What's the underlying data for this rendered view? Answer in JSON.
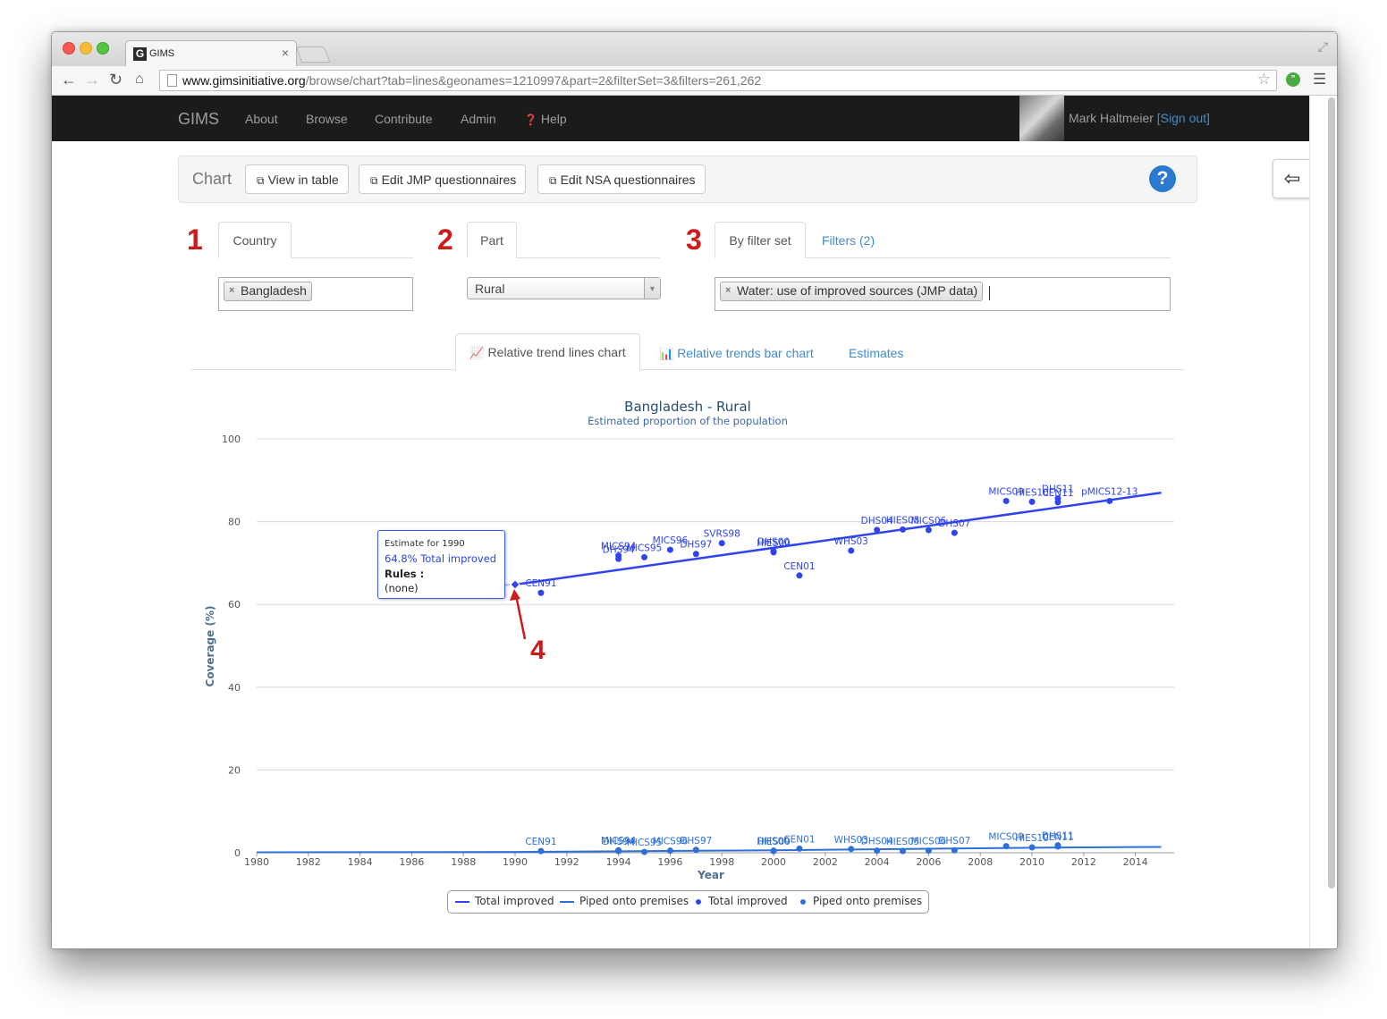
{
  "browser": {
    "tab_title": "GIMS",
    "favicon_letter": "G",
    "url_host": "www.gimsinitiative.org",
    "url_path": "/browse/chart?tab=lines&geonames=1210997&part=2&filterSet=3&filters=261,262"
  },
  "navbar": {
    "brand": "GIMS",
    "links": [
      "About",
      "Browse",
      "Contribute",
      "Admin",
      "Help"
    ],
    "user_name": "Mark Haltmeier",
    "sign_out": "[Sign out]"
  },
  "chart_toolbar": {
    "label": "Chart",
    "buttons": [
      "View in table",
      "Edit JMP questionnaires",
      "Edit NSA questionnaires"
    ]
  },
  "steps": {
    "one": "1",
    "two": "2",
    "three": "3",
    "four": "4"
  },
  "panels": {
    "country_tab": "Country",
    "country_value": "Bangladesh",
    "part_tab": "Part",
    "part_value": "Rural",
    "filterset_tab": "By filter set",
    "filters_tab": "Filters (2)",
    "filterset_value": "Water: use of improved sources (JMP data)"
  },
  "view_tabs": [
    "Relative trend lines chart",
    "Relative trends bar chart",
    "Estimates"
  ],
  "tooltip": {
    "header": "Estimate for 1990",
    "value": "64.8% Total improved",
    "rules_label": "Rules :",
    "rules_value": "(none)"
  },
  "colors": {
    "series_total_line": "#2f44ef",
    "series_piped_line": "#2f6fd8",
    "annotation_red": "#cc1b1b",
    "link_blue": "#428bca"
  },
  "chart_data": {
    "type": "scatter",
    "title": "Bangladesh - Rural",
    "subtitle": "Estimated proportion of the population",
    "xlabel": "Year",
    "ylabel": "Coverage (%)",
    "xlim": [
      1980,
      2015
    ],
    "ylim": [
      0,
      100
    ],
    "x_ticks": [
      1980,
      1982,
      1984,
      1986,
      1988,
      1990,
      1992,
      1994,
      1996,
      1998,
      2000,
      2002,
      2004,
      2006,
      2008,
      2010,
      2012,
      2014
    ],
    "y_ticks": [
      0,
      20,
      40,
      60,
      80,
      100
    ],
    "grid": true,
    "legend_position": "bottom-center",
    "legend": [
      "Total improved",
      "Piped onto premises",
      "Total improved",
      "Piped onto premises"
    ],
    "series": [
      {
        "name": "Total improved",
        "kind": "line",
        "color": "#2f44ef",
        "points": [
          [
            1990,
            64.8
          ],
          [
            2015,
            87
          ]
        ]
      },
      {
        "name": "Piped onto premises",
        "kind": "line",
        "color": "#2f6fd8",
        "points": [
          [
            1980,
            0.1
          ],
          [
            1990,
            0.2
          ],
          [
            2000,
            0.6
          ],
          [
            2010,
            1.2
          ],
          [
            2015,
            1.4
          ]
        ]
      },
      {
        "name": "Total improved",
        "kind": "points",
        "color": "#2f44ef",
        "points": [
          {
            "x": 1991,
            "y": 62.8,
            "label": "CEN91"
          },
          {
            "x": 1994,
            "y": 71.8,
            "label": "MICS94"
          },
          {
            "x": 1994,
            "y": 71.0,
            "label": "DHS94"
          },
          {
            "x": 1995,
            "y": 71.4,
            "label": "MICS95"
          },
          {
            "x": 1996,
            "y": 73.2,
            "label": "MICS96"
          },
          {
            "x": 1997,
            "y": 72.2,
            "label": "DHS97"
          },
          {
            "x": 1998,
            "y": 74.8,
            "label": "SVRS98"
          },
          {
            "x": 2000,
            "y": 72.6,
            "label": "HIES00"
          },
          {
            "x": 2000,
            "y": 72.9,
            "label": "DHS00"
          },
          {
            "x": 2001,
            "y": 67.0,
            "label": "CEN01"
          },
          {
            "x": 2003,
            "y": 73.0,
            "label": "WHS03"
          },
          {
            "x": 2004,
            "y": 78.0,
            "label": "DHS04"
          },
          {
            "x": 2005,
            "y": 78.1,
            "label": "HIES05"
          },
          {
            "x": 2006,
            "y": 78.0,
            "label": "MICS06"
          },
          {
            "x": 2007,
            "y": 77.3,
            "label": "DHS07"
          },
          {
            "x": 2009,
            "y": 85.0,
            "label": "MICS09"
          },
          {
            "x": 2010,
            "y": 84.8,
            "label": "HIES10"
          },
          {
            "x": 2011,
            "y": 84.7,
            "label": "CEN11"
          },
          {
            "x": 2011,
            "y": 85.6,
            "label": "DHS11"
          },
          {
            "x": 2013,
            "y": 85.0,
            "label": "pMICS12-13"
          }
        ]
      },
      {
        "name": "Piped onto premises",
        "kind": "points",
        "color": "#2f6fd8",
        "points": [
          {
            "x": 1991,
            "y": 0.4,
            "label": "CEN91"
          },
          {
            "x": 1994,
            "y": 0.6,
            "label": "MICS94"
          },
          {
            "x": 1994,
            "y": 0.4,
            "label": "DHS94"
          },
          {
            "x": 1995,
            "y": 0.2,
            "label": "MICS95"
          },
          {
            "x": 1996,
            "y": 0.5,
            "label": "MICS96"
          },
          {
            "x": 1997,
            "y": 0.7,
            "label": "DHS97"
          },
          {
            "x": 2000,
            "y": 0.4,
            "label": "HIES00"
          },
          {
            "x": 2000,
            "y": 0.5,
            "label": "DHS00"
          },
          {
            "x": 2001,
            "y": 1.0,
            "label": "CEN01"
          },
          {
            "x": 2003,
            "y": 0.9,
            "label": "WHS03"
          },
          {
            "x": 2004,
            "y": 0.5,
            "label": "DHS04"
          },
          {
            "x": 2005,
            "y": 0.4,
            "label": "HIES05"
          },
          {
            "x": 2006,
            "y": 0.5,
            "label": "MICS06"
          },
          {
            "x": 2007,
            "y": 0.6,
            "label": "DHS07"
          },
          {
            "x": 2009,
            "y": 1.6,
            "label": "MICS09"
          },
          {
            "x": 2010,
            "y": 1.3,
            "label": "HIES10"
          },
          {
            "x": 2011,
            "y": 1.5,
            "label": "CEN11"
          },
          {
            "x": 2011,
            "y": 1.8,
            "label": "DHS11"
          }
        ]
      }
    ],
    "highlight": {
      "x": 1990,
      "y": 64.8
    }
  }
}
